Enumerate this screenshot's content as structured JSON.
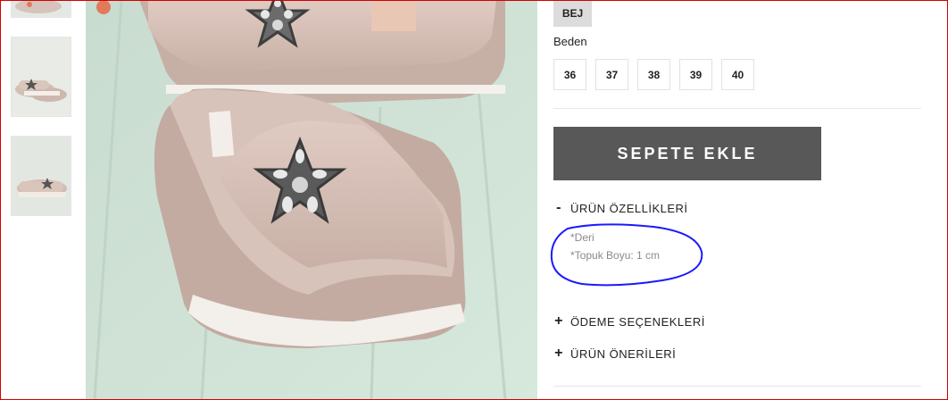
{
  "product": {
    "color": {
      "label": "BEJ",
      "swatch": "#dcdcdc"
    },
    "size_label": "Beden",
    "sizes": [
      "36",
      "37",
      "38",
      "39",
      "40"
    ],
    "add_to_cart_label": "SEPETE EKLE"
  },
  "accordion": {
    "features": {
      "title": "ÜRÜN ÖZELLİKLERİ",
      "icon": "minus-icon",
      "items": [
        "*Deri",
        "*Topuk Boyu: 1 cm"
      ]
    },
    "payment": {
      "title": "ÖDEME SEÇENEKLERİ",
      "icon": "plus-icon"
    },
    "recommendations": {
      "title": "ÜRÜN ÖNERİLERİ",
      "icon": "plus-icon"
    }
  },
  "colors": {
    "button_bg": "#585858",
    "annotation": "#1a1aff",
    "background_mint": "#cfe3d6",
    "shoe_beige": "#d8c3bb"
  }
}
